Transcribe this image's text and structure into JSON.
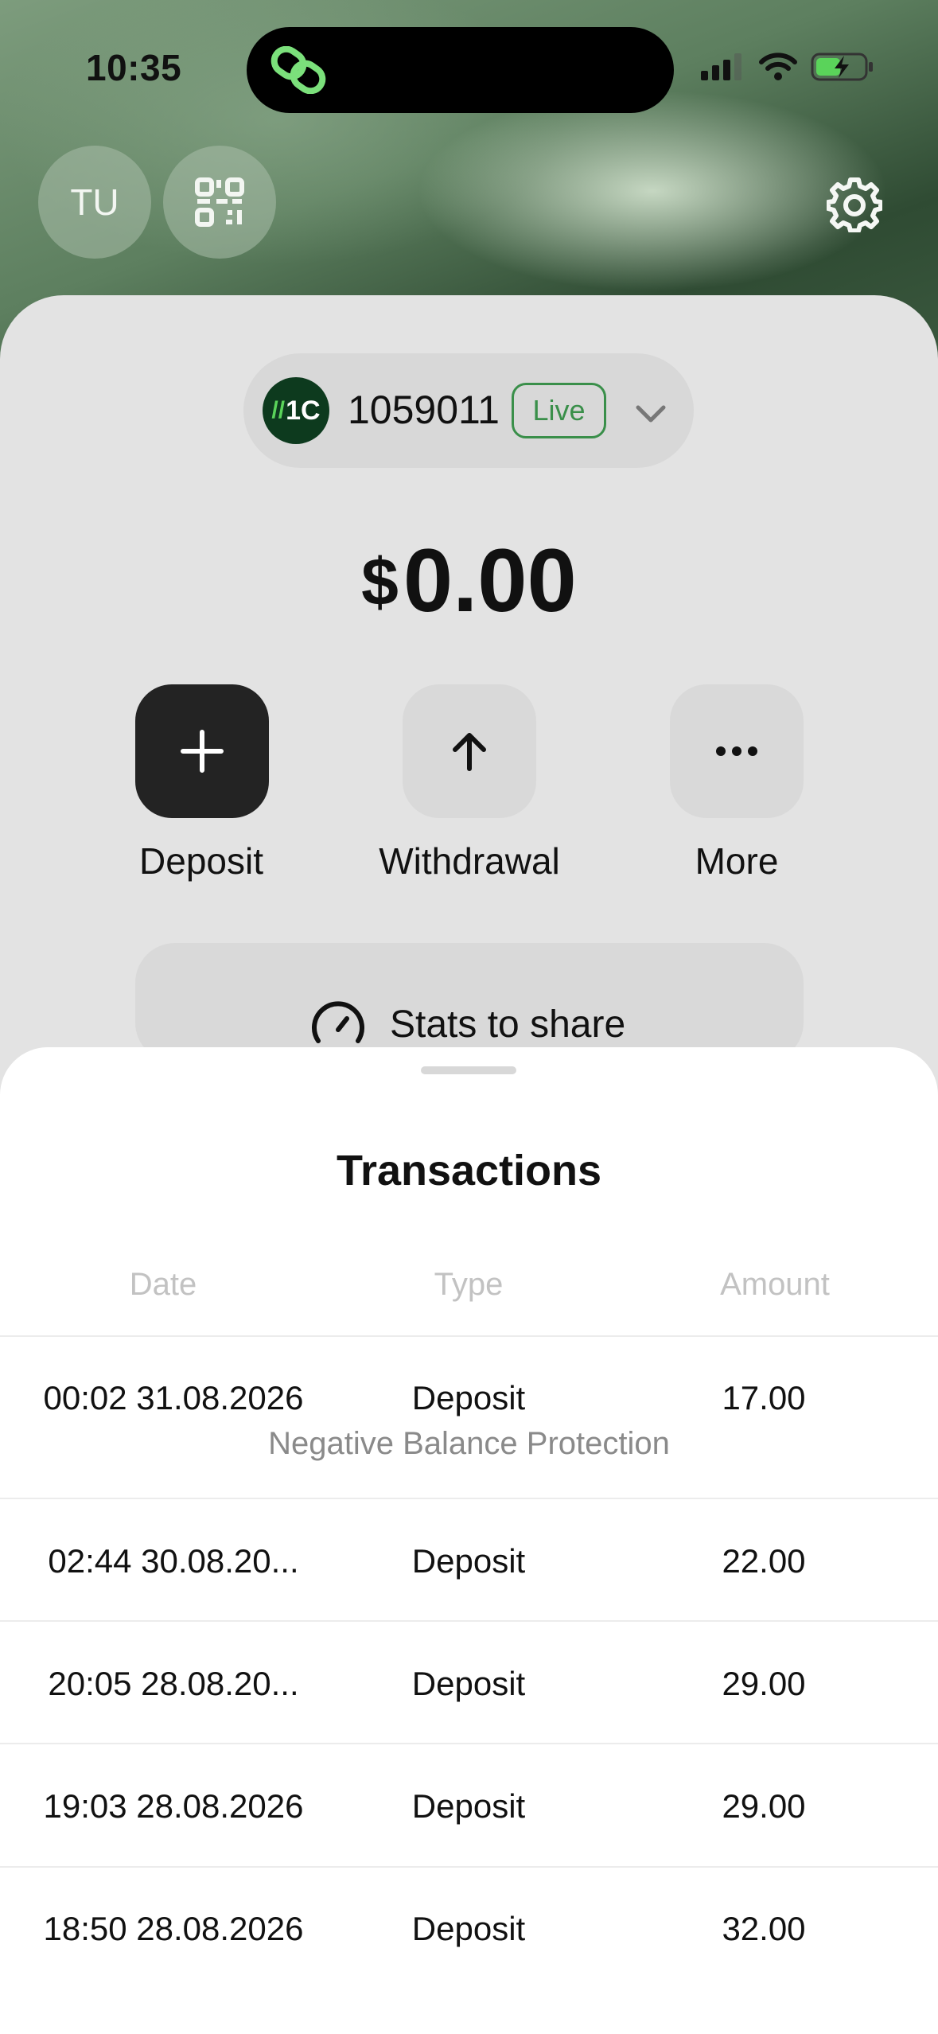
{
  "status_bar": {
    "time": "10:35"
  },
  "top_bar": {
    "avatar_initials": "TU",
    "qr_icon": "qr-code-icon",
    "settings_icon": "gear-icon"
  },
  "account": {
    "logo_text": "1C",
    "number": "1059011",
    "badge": "Live",
    "badge_color": "#3a8f4a"
  },
  "balance": {
    "currency": "$",
    "amount": "0.00"
  },
  "actions": [
    {
      "label": "Deposit",
      "icon": "plus-icon"
    },
    {
      "label": "Withdrawal",
      "icon": "arrow-up-icon"
    },
    {
      "label": "More",
      "icon": "more-dots-icon"
    }
  ],
  "stats": {
    "label": "Stats to share",
    "icon": "speedometer-icon"
  },
  "transactions": {
    "title": "Transactions",
    "columns": [
      "Date",
      "Type",
      "Amount"
    ],
    "rows": [
      {
        "date": "00:02 31.08.2026",
        "type": "Deposit",
        "amount": "17.00",
        "note": "Negative Balance Protection"
      },
      {
        "date": "02:44 30.08.20...",
        "type": "Deposit",
        "amount": "22.00"
      },
      {
        "date": "20:05 28.08.20...",
        "type": "Deposit",
        "amount": "29.00"
      },
      {
        "date": "19:03 28.08.2026",
        "type": "Deposit",
        "amount": "29.00"
      },
      {
        "date": "18:50 28.08.2026",
        "type": "Deposit",
        "amount": "32.00"
      }
    ]
  }
}
